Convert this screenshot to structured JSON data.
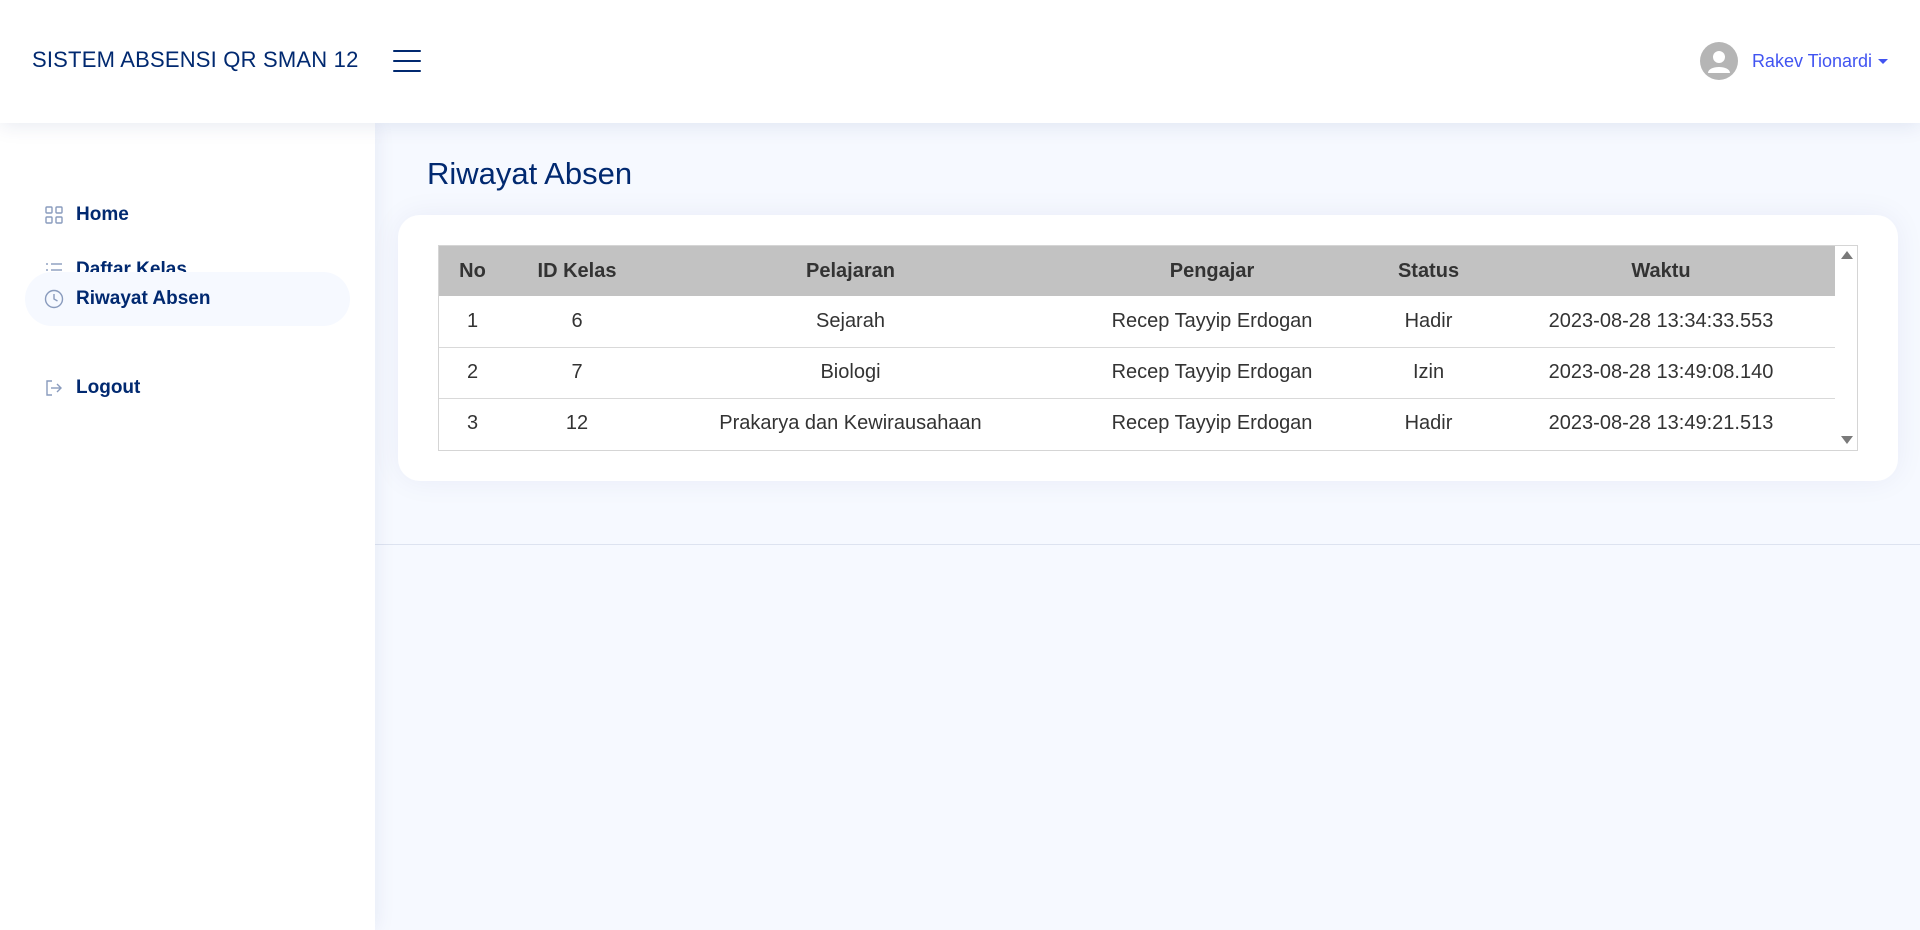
{
  "header": {
    "brand": "SISTEM ABSENSI QR SMAN 12",
    "user_name": "Rakev Tionardi"
  },
  "sidebar": {
    "items": [
      {
        "label": "Home",
        "icon": "grid-icon",
        "active": false
      },
      {
        "label": "Daftar Kelas",
        "icon": "list-icon",
        "active": false
      },
      {
        "label": "Riwayat Absen",
        "icon": "clock-icon",
        "active": true
      },
      {
        "label": "Logout",
        "icon": "logout-icon",
        "active": false
      }
    ]
  },
  "main": {
    "title": "Riwayat Absen",
    "table": {
      "headers": [
        "No",
        "ID Kelas",
        "Pelajaran",
        "Pengajar",
        "Status",
        "Waktu"
      ],
      "rows": [
        [
          "1",
          "6",
          "Sejarah",
          "Recep Tayyip Erdogan",
          "Hadir",
          "2023-08-28 13:34:33.553"
        ],
        [
          "2",
          "7",
          "Biologi",
          "Recep Tayyip Erdogan",
          "Izin",
          "2023-08-28 13:49:08.140"
        ],
        [
          "3",
          "12",
          "Prakarya dan Kewirausahaan",
          "Recep Tayyip Erdogan",
          "Hadir",
          "2023-08-28 13:49:21.513"
        ]
      ]
    }
  },
  "colors": {
    "primary": "#012970",
    "accent": "#4154f1",
    "background": "#f6f9ff",
    "table_header": "#c2c2c2"
  }
}
